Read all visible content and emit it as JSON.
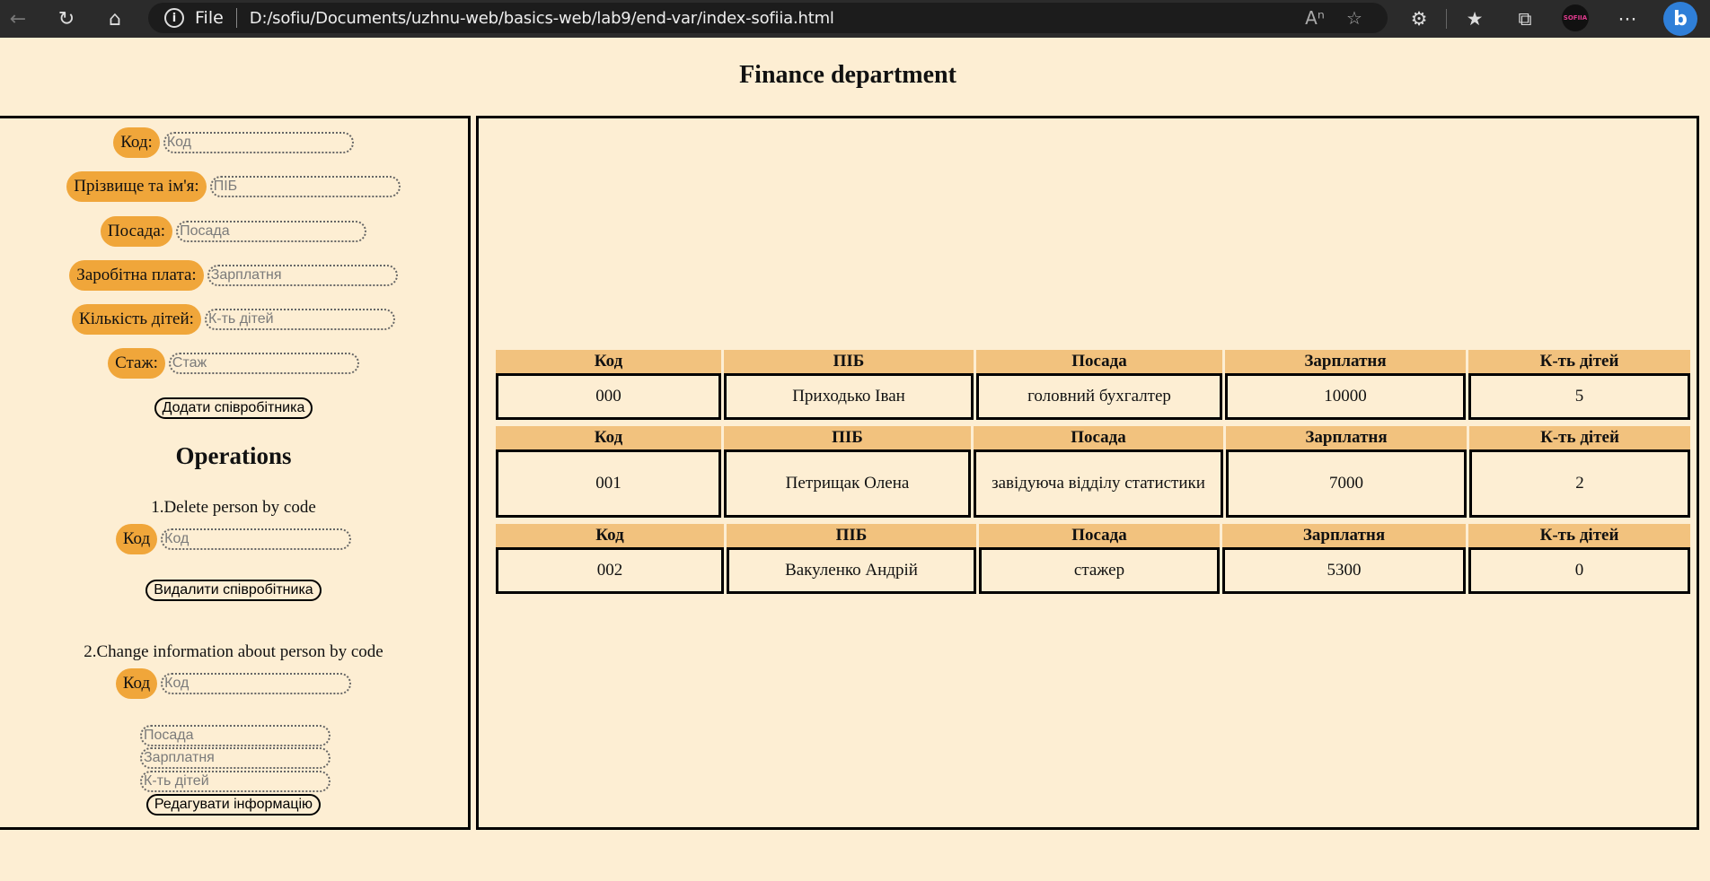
{
  "browser": {
    "file_label": "File",
    "url": "D:/sofiu/Documents/uzhnu-web/basics-web/lab9/end-var/index-sofiia.html",
    "profile_text": "SOFIIA"
  },
  "page": {
    "title": "Finance department"
  },
  "add_form": {
    "fields": [
      {
        "label": "Код:",
        "placeholder": "Код"
      },
      {
        "label": "Прізвище та ім'я:",
        "placeholder": "ПІБ"
      },
      {
        "label": "Посада:",
        "placeholder": "Посада"
      },
      {
        "label": "Заробітна плата:",
        "placeholder": "Зарплатня"
      },
      {
        "label": "Кількість дітей:",
        "placeholder": "К-ть дітей"
      },
      {
        "label": "Стаж:",
        "placeholder": "Стаж"
      }
    ],
    "submit_label": "Додати співробітника"
  },
  "operations": {
    "title": "Operations",
    "delete": {
      "caption": "1.Delete person by code",
      "code_label": "Код",
      "code_placeholder": "Код",
      "button_label": "Видалити співробітника"
    },
    "change": {
      "caption": "2.Change information about person by code",
      "code_label": "Код",
      "code_placeholder": "Код",
      "position_placeholder": "Посада",
      "salary_placeholder": "Зарплатня",
      "children_placeholder": "К-ть дітей",
      "button_label": "Редагувати інформацію"
    }
  },
  "table": {
    "headers": [
      "Код",
      "ПІБ",
      "Посада",
      "Зарплатня",
      "К-ть дітей"
    ],
    "rows": [
      [
        "000",
        "Приходько Іван",
        "головний бухгалтер",
        "10000",
        "5"
      ],
      [
        "001",
        "Петрищак Олена",
        "завідуюча відділу статистики",
        "7000",
        "2"
      ],
      [
        "002",
        "Вакуленко Андрій",
        "стажер",
        "5300",
        "0"
      ]
    ]
  },
  "colors": {
    "background": "#fdeed3",
    "label_pill": "#f0a63a",
    "table_header": "#f2c27e"
  }
}
